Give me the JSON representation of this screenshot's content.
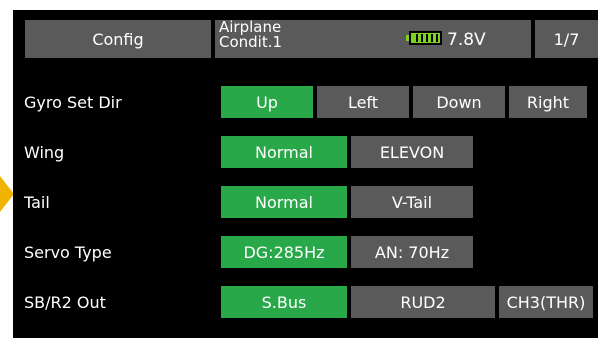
{
  "header": {
    "title": "Config",
    "model_type": "Airplane",
    "condition": "Condit.1",
    "battery_voltage": "7.8V",
    "page": "1/7"
  },
  "icons": {
    "battery": "battery-icon",
    "focus": "arrow-pointer-icon"
  },
  "colors": {
    "selected": "#28a848",
    "unselected": "#5a5a5a",
    "background": "#000000",
    "pointer": "#f0b400"
  },
  "rows": [
    {
      "label": "Gyro Set Dir",
      "options": [
        "Up",
        "Left",
        "Down",
        "Right"
      ],
      "selected": "Up"
    },
    {
      "label": "Wing",
      "options": [
        "Normal",
        "ELEVON"
      ],
      "selected": "Normal"
    },
    {
      "label": "Tail",
      "options": [
        "Normal",
        "V-Tail"
      ],
      "selected": "Normal"
    },
    {
      "label": "Servo Type",
      "options": [
        "DG:285Hz",
        "AN: 70Hz"
      ],
      "selected": "DG:285Hz"
    },
    {
      "label": "SB/R2 Out",
      "options": [
        "S.Bus",
        "RUD2",
        "CH3(THR)"
      ],
      "selected": "S.Bus"
    }
  ]
}
